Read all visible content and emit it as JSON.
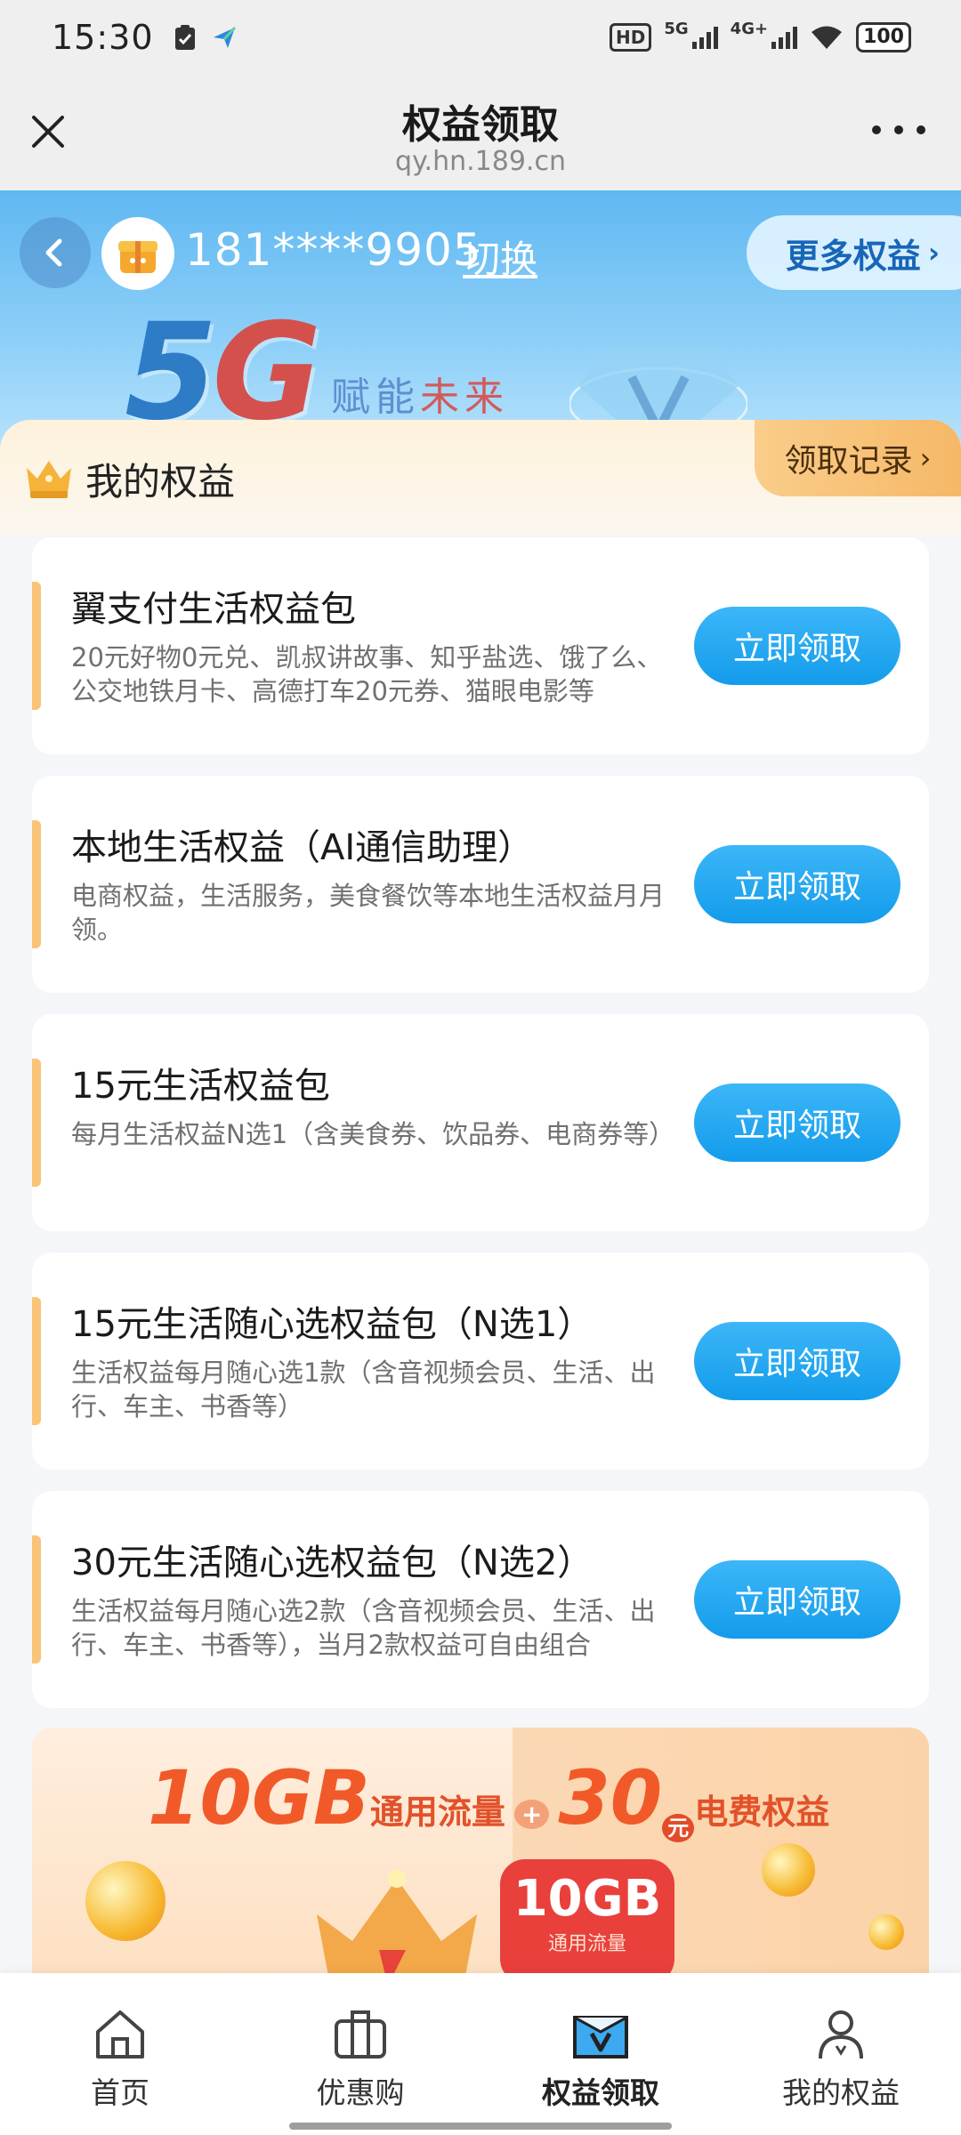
{
  "status_bar": {
    "time": "15:30",
    "hd_badge": "HD",
    "net_5g": "5G",
    "net_4g": "4G+",
    "battery": "100"
  },
  "title_bar": {
    "title": "权益领取",
    "subtitle": "qy.hn.189.cn"
  },
  "hero": {
    "phone": "181****9905",
    "switch_label": "切换",
    "more_rights_label": "更多权益",
    "more_arrow": "›",
    "brand_5": "5",
    "brand_g": "G",
    "slogan_a": "赋能",
    "slogan_b": "未来"
  },
  "my_rights": {
    "title": "我的权益",
    "records_label": "领取记录",
    "records_arrow": "›"
  },
  "benefits": [
    {
      "title": "翼支付生活权益包",
      "desc": "20元好物0元兑、凯叔讲故事、知乎盐选、饿了么、公交地铁月卡、高德打车20元券、猫眼电影等",
      "button": "立即领取"
    },
    {
      "title": "本地生活权益（AI通信助理）",
      "desc": "电商权益，生活服务，美食餐饮等本地生活权益月月领。",
      "button": "立即领取"
    },
    {
      "title": "15元生活权益包",
      "desc": "每月生活权益N选1（含美食券、饮品券、电商券等）",
      "button": "立即领取"
    },
    {
      "title": "15元生活随心选权益包（N选1）",
      "desc": "生活权益每月随心选1款（含音视频会员、生活、出行、车主、书香等）",
      "button": "立即领取"
    },
    {
      "title": "30元生活随心选权益包（N选2）",
      "desc": "生活权益每月随心选2款（含音视频会员、生活、出行、车主、书香等），当月2款权益可自由组合",
      "button": "立即领取"
    }
  ],
  "promo": {
    "big1": "10GB",
    "text1": "通用流量",
    "plus": "+",
    "big2": "30",
    "yuan": "元",
    "text2": "电费权益",
    "badge_big": "10GB",
    "badge_small": "通用流量"
  },
  "bottom_nav": [
    {
      "label": "首页",
      "icon": "home-icon"
    },
    {
      "label": "优惠购",
      "icon": "shopping-bag-icon"
    },
    {
      "label": "权益领取",
      "icon": "rights-claim-icon"
    },
    {
      "label": "我的权益",
      "icon": "profile-icon"
    }
  ],
  "colors": {
    "accent_blue": "#139ceb",
    "card_accent": "#f9c478",
    "records_gold": "#f6b867"
  }
}
